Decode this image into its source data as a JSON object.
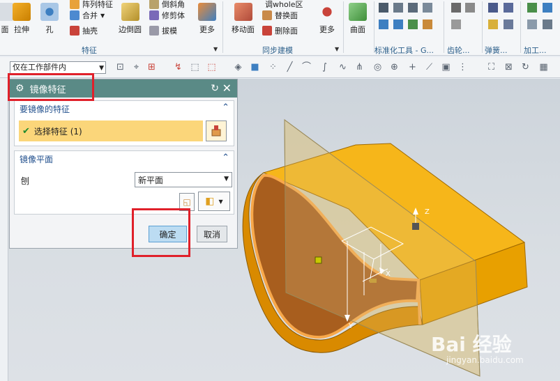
{
  "ribbon": {
    "partial_left_label": "面",
    "extrude_label": "拉伸",
    "hole_label": "孔",
    "pattern_feature_label": "阵列特征",
    "unite_label": "合并",
    "shell_label": "抽壳",
    "edge_blend_label": "边倒圆",
    "chamfer_label": "倒斜角",
    "trim_body_label": "修剪体",
    "draft_label": "拔模",
    "more_label_1": "更多",
    "move_face_label": "移动面",
    "resize_region_label": "调whole区域",
    "replace_face_label": "替换面",
    "delete_face_label": "删除面",
    "more_label_2": "更多",
    "surface_label": "曲面",
    "more_label_3": "更多",
    "group_feature": "特征",
    "group_sync": "同步建模",
    "group_std_tools": "标准化工具 - G...",
    "group_gear": "齿轮...",
    "group_spring": "弹簧...",
    "group_process": "加工..."
  },
  "toolbar": {
    "selection_filter": "仅在工作部件内"
  },
  "dialog": {
    "title": "镜像特征",
    "section_features": "要镜像的特征",
    "select_feature": "选择特征 (1)",
    "section_plane": "镜像平面",
    "plane_label": "刨",
    "plane_option": "新平面",
    "ok": "确定",
    "cancel": "取消"
  },
  "viewport": {
    "axis_z": "Z",
    "axis_x": "X",
    "axis_y": "Y"
  },
  "watermark": {
    "brand": "Bai 经验",
    "url": "jingyan.baidu.com"
  },
  "colors": {
    "dialog_title_bg": "#5a8a86",
    "selection_highlight": "#fbd67a",
    "part_orange": "#f5a800",
    "highlight_box": "#e0202a",
    "ok_button": "#bcdcf2"
  }
}
